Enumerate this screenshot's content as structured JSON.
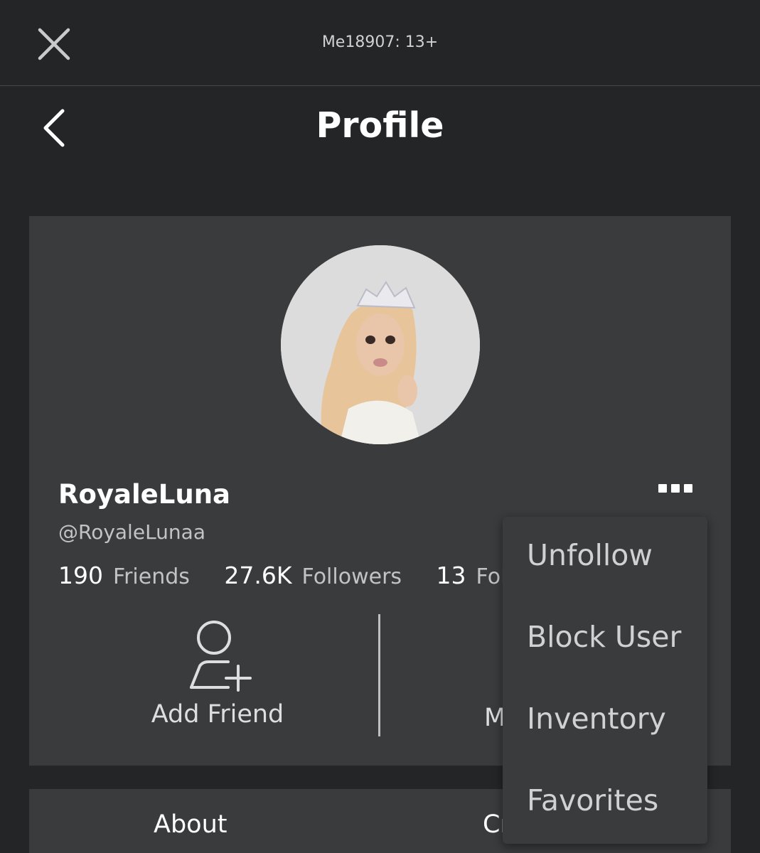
{
  "header": {
    "account_label": "Me18907: 13+",
    "close_icon": "close-icon",
    "back_icon": "chevron-left-icon",
    "title": "Profile"
  },
  "profile": {
    "display_name": "RoyaleLuna",
    "username": "@RoyaleLunaa",
    "stats": [
      {
        "value": "190",
        "label": "Friends"
      },
      {
        "value": "27.6K",
        "label": "Followers"
      },
      {
        "value": "13",
        "label": "Foll"
      }
    ]
  },
  "actions": {
    "add_friend": "Add Friend",
    "message_partial": "M"
  },
  "menu": {
    "items": [
      "Unfollow",
      "Block User",
      "Inventory",
      "Favorites"
    ]
  },
  "tabs": {
    "about": "About",
    "creations_partial": "Cr"
  },
  "colors": {
    "background": "#232527",
    "card": "#393b3d",
    "text": "#ffffff",
    "muted_text": "#c1c3c5"
  }
}
